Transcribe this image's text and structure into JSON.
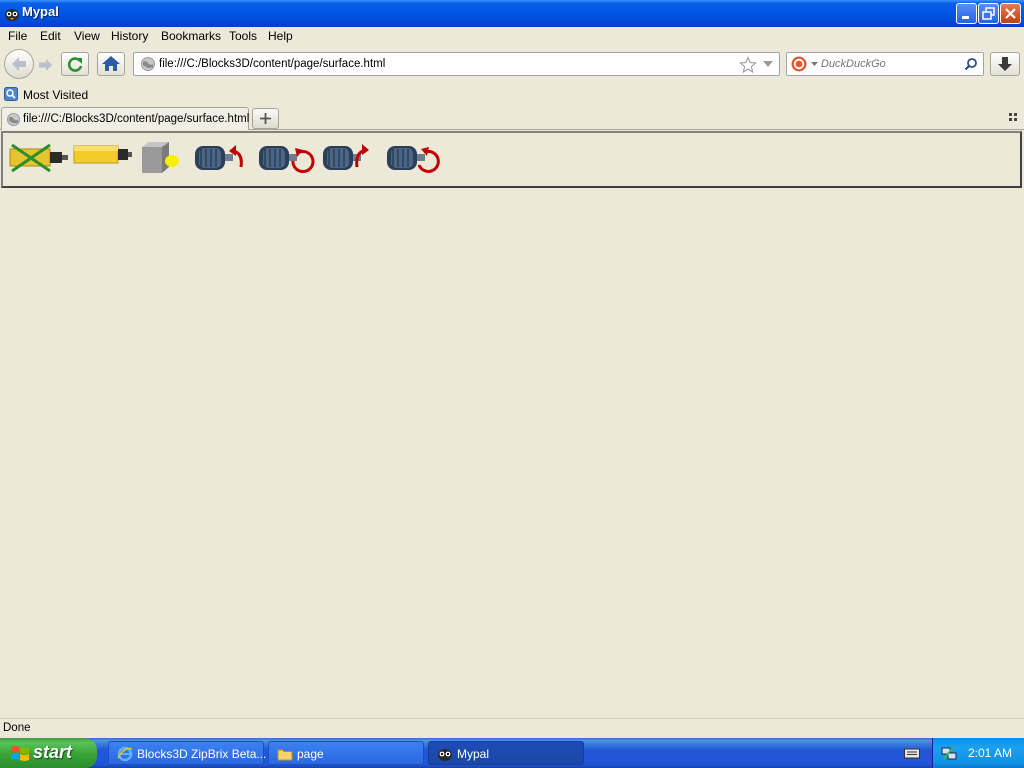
{
  "window": {
    "title": "Mypal"
  },
  "menu": {
    "items": [
      "File",
      "Edit",
      "View",
      "History",
      "Bookmarks",
      "Tools",
      "Help"
    ]
  },
  "nav": {
    "url": "file:///C:/Blocks3D/content/page/surface.html",
    "search_placeholder": "DuckDuckGo"
  },
  "bookmarks": {
    "most_visited": "Most Visited"
  },
  "tabs": [
    {
      "label": "file:///C:/Blocks3D/content/page/surface.html"
    }
  ],
  "page": {
    "buttons": [
      {
        "icon": "crossed-hinge-icon"
      },
      {
        "icon": "hinge-icon"
      },
      {
        "icon": "motor-block-icon"
      },
      {
        "icon": "motor-rotate-left-icon"
      },
      {
        "icon": "motor-rotate-ccw-icon"
      },
      {
        "icon": "motor-rotate-right-icon"
      },
      {
        "icon": "motor-rotate-cw-icon"
      }
    ]
  },
  "status": {
    "text": "Done"
  },
  "taskbar": {
    "start": "start",
    "tasks": [
      {
        "label": "Blocks3D ZipBrix Beta..."
      },
      {
        "label": "page"
      },
      {
        "label": "Mypal"
      }
    ],
    "clock": "2:01 AM"
  }
}
